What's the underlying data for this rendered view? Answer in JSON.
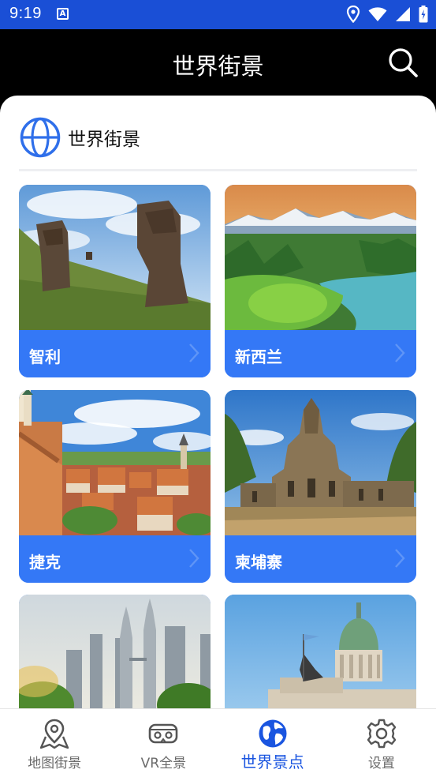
{
  "status_bar": {
    "time": "9:19",
    "notification_letter": "A"
  },
  "header": {
    "title": "世界街景",
    "search_icon": "search-icon"
  },
  "section": {
    "icon": "globe-icon",
    "title": "世界街景"
  },
  "cards": [
    {
      "label": "智利",
      "image": "easter-island-moai"
    },
    {
      "label": "新西兰",
      "image": "new-zealand-lake-mountains"
    },
    {
      "label": "捷克",
      "image": "cesky-krumlov-town"
    },
    {
      "label": "柬埔寨",
      "image": "angkor-temple"
    },
    {
      "label": "",
      "image": "kuala-lumpur-towers"
    },
    {
      "label": "",
      "image": "buenos-aires-congress-dome"
    }
  ],
  "bottom_nav": [
    {
      "label": "地图街景",
      "icon": "map-pin-icon",
      "active": false
    },
    {
      "label": "VR全景",
      "icon": "vr-goggles-icon",
      "active": false
    },
    {
      "label": "世界景点",
      "icon": "earth-icon",
      "active": true
    },
    {
      "label": "设置",
      "icon": "gear-icon",
      "active": false
    }
  ],
  "colors": {
    "status_bar": "#1a4fd6",
    "header": "#000000",
    "accent": "#3478f6",
    "nav_active": "#1a55e0"
  }
}
